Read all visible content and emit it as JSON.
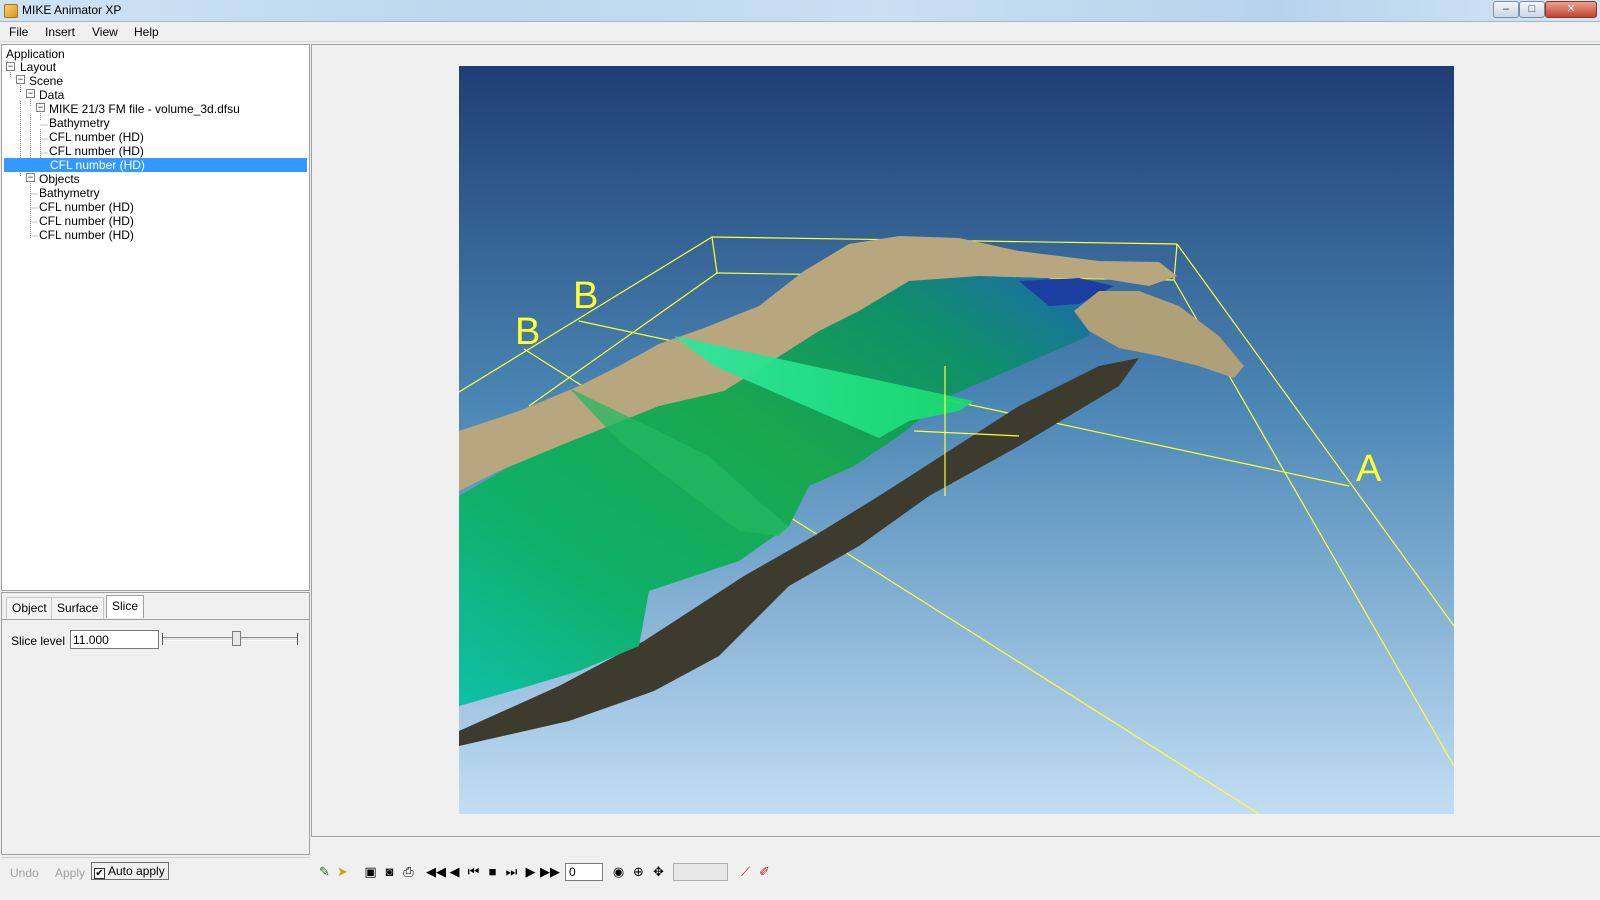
{
  "window": {
    "title": "MIKE Animator XP",
    "min_symbol": "–",
    "max_symbol": "□",
    "close_symbol": "✕"
  },
  "menu": [
    "File",
    "Insert",
    "View",
    "Help"
  ],
  "tree": {
    "root": "Application",
    "layout": "Layout",
    "scene": "Scene",
    "data_folder": "Data",
    "file": "MIKE 21/3 FM file - volume_3d.dfsu",
    "data_items": [
      "Bathymetry",
      "CFL number (HD)",
      "CFL number (HD)",
      "CFL number (HD)"
    ],
    "objects_folder": "Objects",
    "object_items": [
      "Bathymetry",
      "CFL number (HD)",
      "CFL number (HD)",
      "CFL number (HD)"
    ],
    "selected_index": 3
  },
  "properties": {
    "tabs": [
      "Object",
      "Surface",
      "Slice"
    ],
    "active_tab": "Slice",
    "slice_level_label": "Slice level",
    "slice_level_value": "11.000"
  },
  "bottom_buttons": {
    "undo": "Undo",
    "apply": "Apply",
    "auto_apply": "Auto apply",
    "auto_apply_checked": true,
    "check_glyph": "✔"
  },
  "viewport": {
    "label_a": "A",
    "label_b1": "B",
    "label_b2": "B",
    "sky_top_color": "#1f3e73",
    "sky_bottom_color": "#c2def5",
    "annotation_color": "#ffff33",
    "land_color": "#b8a77e",
    "water_color": "#19b14d"
  },
  "toolbar": {
    "frame_value": "0",
    "icons": [
      "draw-icon",
      "pointer-icon",
      "camera-video-icon",
      "camera-icon",
      "print-icon",
      "rewind-start-icon",
      "step-back-icon",
      "skip-back-icon",
      "stop-icon",
      "skip-forward-icon",
      "step-forward-icon",
      "fast-forward-icon",
      "eye-icon",
      "crosshair-icon",
      "move-icon",
      "line-icon",
      "pen-icon"
    ]
  }
}
